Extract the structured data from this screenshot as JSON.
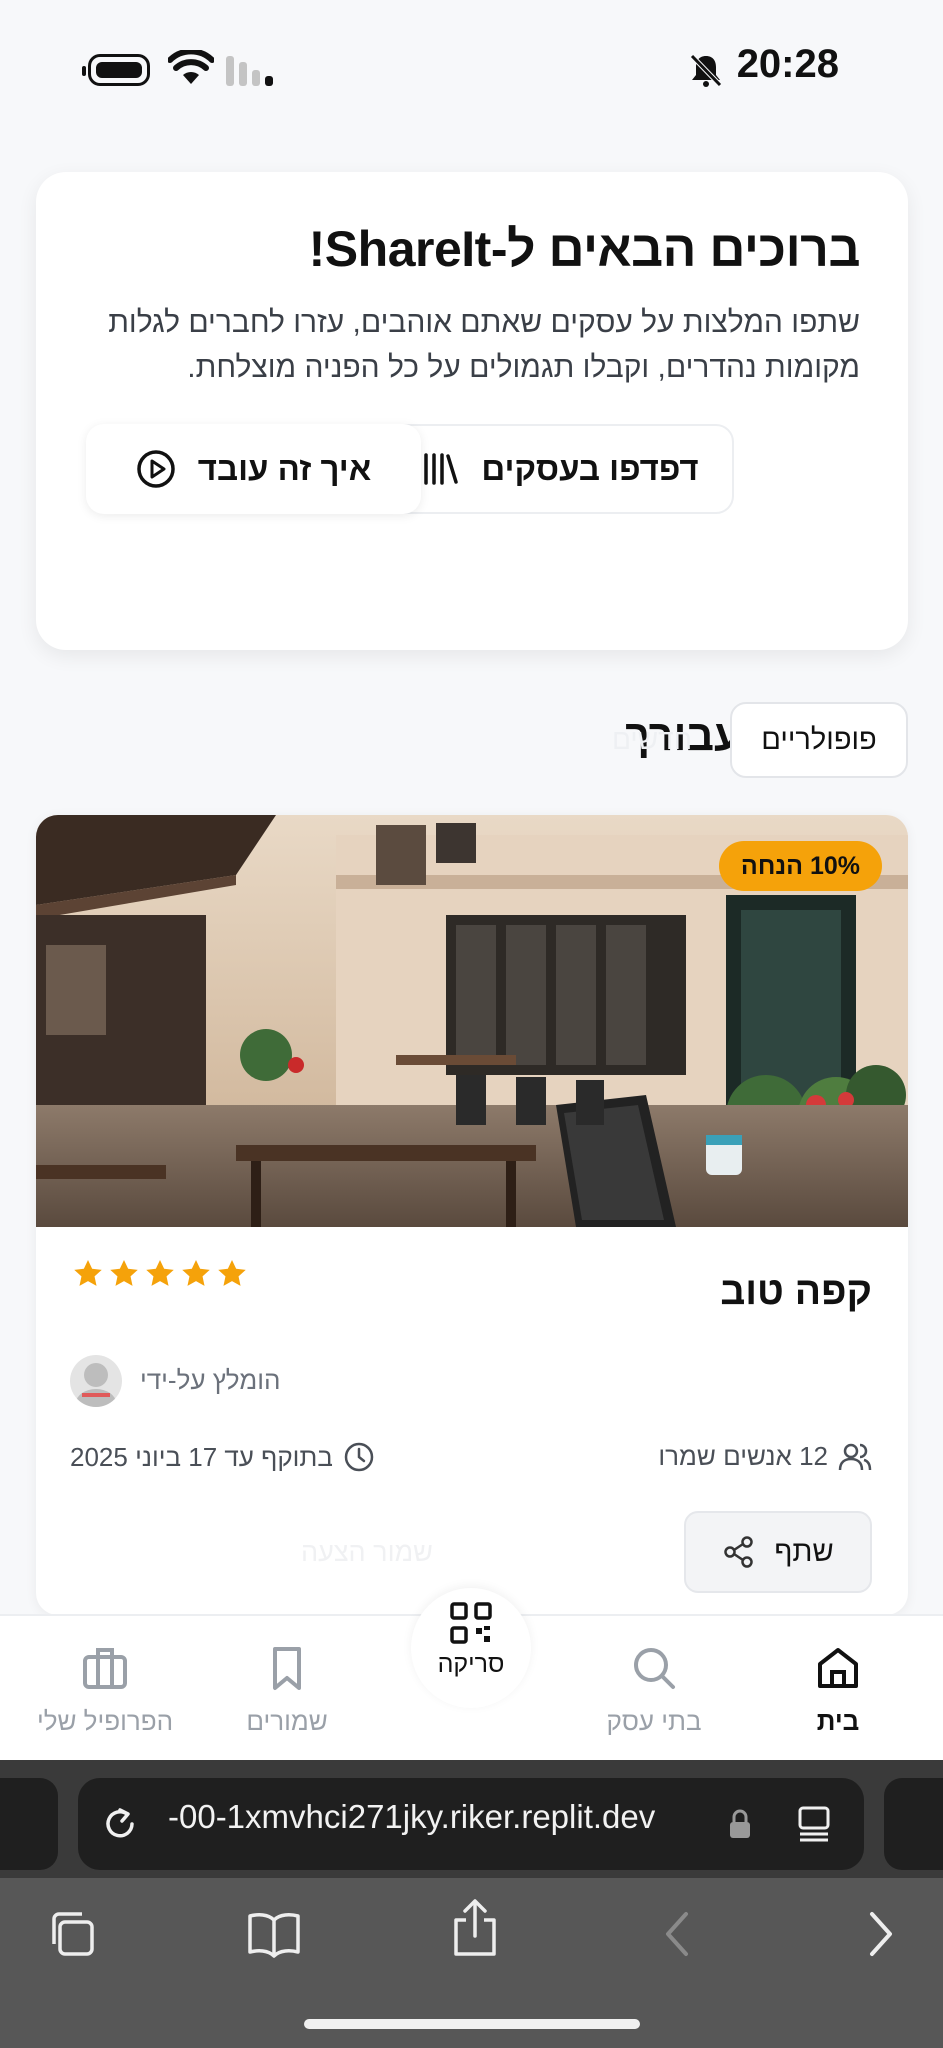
{
  "status_bar": {
    "time": "20:28"
  },
  "hero": {
    "title": "ברוכים הבאים ל-ShareIt!",
    "description": "שתפו המלצות על עסקים שאתם אוהבים, עזרו לחברים לגלות מקומות נהדרים, וקבלו תגמולים על כל הפניה מוצלחת.",
    "browse_button": "דפדפו בעסקים",
    "how_button": "איך זה עובד"
  },
  "recommendations": {
    "title": "המלצות עבורך",
    "tab_popular": "פופולריים",
    "tab_faded": "חדשים"
  },
  "business_card": {
    "discount_badge": "10% הנחה",
    "name": "קפה טוב",
    "rating": 5,
    "recommended_by": "הומלץ על-ידי",
    "saved_count": "12 אנשים שמרו",
    "valid_until": "בתוקף עד 17 ביוני 2025",
    "share_button": "שתף",
    "save_faded": "שמור הצעה",
    "star_color": "#f5a20a"
  },
  "bottom_nav": {
    "home": "בית",
    "businesses": "בתי עסק",
    "scan": "סריקה",
    "saved": "שמורים",
    "profile": "הפרופיל שלי"
  },
  "browser": {
    "url": "-00-1xmvhci271jky.riker.replit.dev"
  }
}
